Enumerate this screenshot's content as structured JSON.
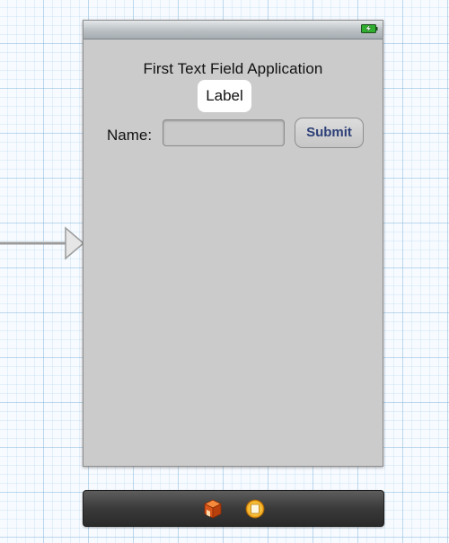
{
  "canvas": {
    "entry_arrow_icon": "initial-view-controller-arrow"
  },
  "view": {
    "status_bar": {
      "battery_icon": "battery-charging-icon",
      "battery_color": "#2fae2f"
    },
    "title": "First Text Field Application",
    "output_label": "Label",
    "name_label": "Name:",
    "name_field": {
      "value": "",
      "placeholder": ""
    },
    "submit_label": "Submit",
    "colors": {
      "background": "#cbcbcb",
      "button_text": "#2d4078"
    }
  },
  "scene_dock": {
    "items": [
      {
        "icon": "first-responder-cube-icon"
      },
      {
        "icon": "view-controller-icon"
      }
    ]
  }
}
